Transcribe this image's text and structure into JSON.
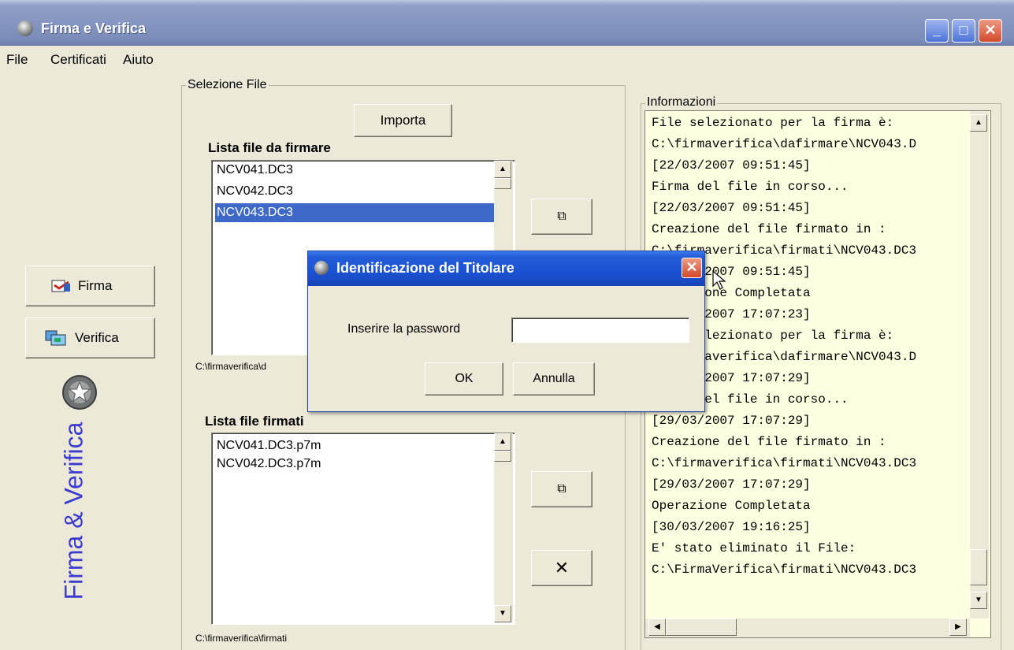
{
  "window": {
    "title": "Firma e Verifica"
  },
  "menu": [
    "File",
    "Certificati",
    "Aiuto"
  ],
  "sidebar": {
    "firma_label": "Firma",
    "verifica_label": "Verifica",
    "brand_text": "Firma & Verifica"
  },
  "file_selection": {
    "group_title": "Selezione File",
    "import_label": "Importa",
    "to_sign": {
      "heading": "Lista file da firmare",
      "items": [
        "NCV041.DC3",
        "NCV042.DC3",
        "NCV043.DC3"
      ],
      "selected_index": 2,
      "path": "C:\\firmaverifica\\d"
    },
    "signed": {
      "heading": "Lista file firmati",
      "items": [
        "NCV041.DC3.p7m",
        "NCV042.DC3.p7m"
      ],
      "path": "C:\\firmaverifica\\firmati"
    }
  },
  "info": {
    "group_title": "Informazioni",
    "lines": [
      "File selezionato per la firma è:",
      "C:\\firmaverifica\\dafirmare\\NCV043.D",
      "[22/03/2007 09:51:45]",
      "Firma del file in corso...",
      "[22/03/2007 09:51:45]",
      "Creazione del file firmato in :",
      "C:\\firmaverifica\\firmati\\NCV043.DC3",
      "[22/03/2007 09:51:45]",
      "Operazione Completata",
      "[29/03/2007 17:07:23]",
      "File selezionato per la firma è:",
      "C:\\firmaverifica\\dafirmare\\NCV043.D",
      "[29/03/2007 17:07:29]",
      "Firma del file in corso...",
      "[29/03/2007 17:07:29]",
      "Creazione del file firmato in :",
      "C:\\firmaverifica\\firmati\\NCV043.DC3",
      "[29/03/2007 17:07:29]",
      "Operazione Completata",
      "[30/03/2007 19:16:25]",
      "E' stato eliminato il File:",
      "C:\\FirmaVerifica\\firmati\\NCV043.DC3"
    ]
  },
  "dialog": {
    "title": "Identificazione del Titolare",
    "password_label": "Inserire la password",
    "password_value": "",
    "ok_label": "OK",
    "cancel_label": "Annulla"
  },
  "colors": {
    "selection": "#3e69c9",
    "info_background": "#ffffe1",
    "brand_text": "#3a3bd0",
    "dialog_title": "#1a52d2"
  }
}
